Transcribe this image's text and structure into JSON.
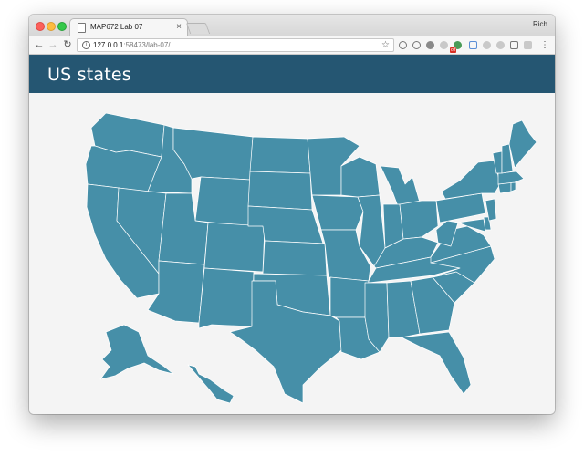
{
  "browser": {
    "tab_title": "MAP672 Lab 07",
    "tab_close": "×",
    "profile_name": "Rich",
    "url_host": "127.0.0.1",
    "url_rest": ":58473/lab-07/",
    "ext_badge": "off",
    "icons": [
      "back-icon",
      "forward-icon",
      "reload-icon",
      "info-icon",
      "star-icon",
      "menu-icon"
    ]
  },
  "page": {
    "title": "US states"
  },
  "colors": {
    "header": "#255672",
    "state_fill": "#468fa8",
    "state_stroke": "#ffffff",
    "page_background": "#f4f4f4"
  }
}
